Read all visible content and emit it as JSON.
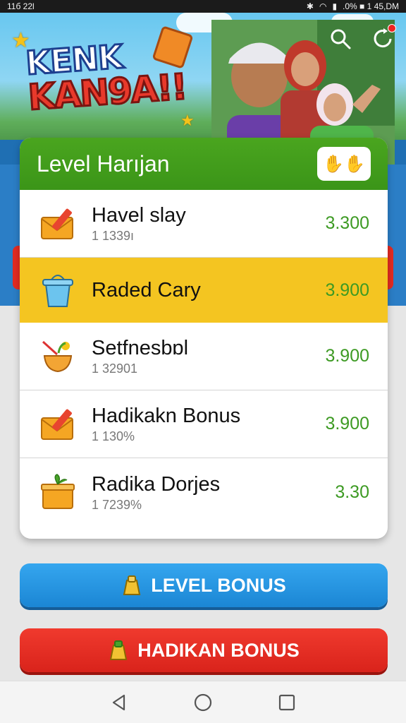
{
  "status_bar": {
    "left": "11б 22l",
    "right": ".0% ■ 1 45,DM"
  },
  "hero": {
    "logo_line1": "KENK",
    "logo_line2": "KAN9A!!"
  },
  "card": {
    "title": "Level Harıjan",
    "items": [
      {
        "name": "Havel slay",
        "sub": "1 1339ı",
        "value": "3.300",
        "icon": "envelope-pencil-icon"
      },
      {
        "name": "Raded Cary",
        "sub": "",
        "value": "3.900",
        "icon": "bucket-icon"
      },
      {
        "name": "Setfnesbɒl",
        "sub": "1 32901",
        "value": "3.900",
        "icon": "bowl-icon"
      },
      {
        "name": "Hadikakn Bonus",
        "sub": "1 130%",
        "value": "3.900",
        "icon": "envelope-pencil-icon"
      },
      {
        "name": "Radika Dorjes",
        "sub": "1 7239%",
        "value": "3.30",
        "icon": "gift-box-icon"
      }
    ]
  },
  "buttons": {
    "level_bonus": "LEVEL BONUS",
    "hadikan_bonus": "HADIKAN BONUS"
  },
  "colors": {
    "header_green": "#3b9518",
    "highlight_yellow": "#f4c521",
    "value_green": "#3d9a23",
    "blue_button": "#1b86d4",
    "red_button": "#d9231b"
  }
}
